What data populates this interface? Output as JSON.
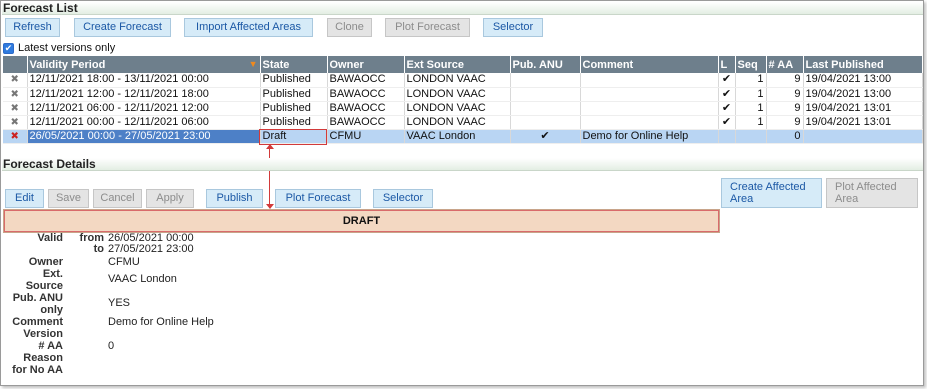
{
  "forecast_list": {
    "title": "Forecast List",
    "buttons": {
      "refresh": "Refresh",
      "create_forecast": "Create Forecast",
      "import_affected_areas": "Import Affected Areas",
      "clone": "Clone",
      "plot_forecast": "Plot Forecast",
      "selector": "Selector"
    },
    "latest_versions_label": "Latest versions only",
    "latest_versions_checked": true,
    "columns": [
      "Validity Period",
      "State",
      "Owner",
      "Ext Source",
      "Pub. ANU",
      "Comment",
      "L",
      "Seq",
      "# AA",
      "Last Published"
    ],
    "rows": [
      {
        "icon": "delete-icon",
        "period": "12/11/2021 18:00 - 13/11/2021 00:00",
        "state": "Published",
        "owner": "BAWAOCC",
        "ext_source": "LONDON VAAC",
        "pub_anu": "",
        "comment": "",
        "l": "✔",
        "seq": "1",
        "aa": "9",
        "last_published": "19/04/2021 13:00"
      },
      {
        "icon": "delete-icon",
        "period": "12/11/2021 12:00 - 12/11/2021 18:00",
        "state": "Published",
        "owner": "BAWAOCC",
        "ext_source": "LONDON VAAC",
        "pub_anu": "",
        "comment": "",
        "l": "✔",
        "seq": "1",
        "aa": "9",
        "last_published": "19/04/2021 13:00"
      },
      {
        "icon": "delete-icon",
        "period": "12/11/2021 06:00 - 12/11/2021 12:00",
        "state": "Published",
        "owner": "BAWAOCC",
        "ext_source": "LONDON VAAC",
        "pub_anu": "",
        "comment": "",
        "l": "✔",
        "seq": "1",
        "aa": "9",
        "last_published": "19/04/2021 13:01"
      },
      {
        "icon": "delete-icon",
        "period": "12/11/2021 00:00 - 12/11/2021 06:00",
        "state": "Published",
        "owner": "BAWAOCC",
        "ext_source": "LONDON VAAC",
        "pub_anu": "",
        "comment": "",
        "l": "✔",
        "seq": "1",
        "aa": "9",
        "last_published": "19/04/2021 13:01"
      },
      {
        "icon": "delete-icon",
        "period": "26/05/2021 00:00 - 27/05/2021 23:00",
        "state": "Draft",
        "owner": "CFMU",
        "ext_source": "VAAC London",
        "pub_anu": "✔",
        "comment": "Demo for Online Help",
        "l": "",
        "seq": "",
        "aa": "0",
        "last_published": ""
      }
    ]
  },
  "forecast_details": {
    "title": "Forecast Details",
    "buttons": {
      "edit": "Edit",
      "save": "Save",
      "cancel": "Cancel",
      "apply": "Apply",
      "publish": "Publish",
      "plot_forecast": "Plot Forecast",
      "selector": "Selector",
      "create_affected_area_1": "Create Affected",
      "create_affected_area_2": "Area",
      "plot_affected_area_1": "Plot Affected",
      "plot_affected_area_2": "Area"
    },
    "state_banner": "DRAFT",
    "fields": {
      "valid_label": "Valid",
      "from_label": "from",
      "from_value": "26/05/2021 00:00",
      "to_label": "to",
      "to_value": "27/05/2021 23:00",
      "owner_label": "Owner",
      "owner_value": "CFMU",
      "ext_source_label_1": "Ext.",
      "ext_source_label_2": "Source",
      "ext_source_value": "VAAC London",
      "pub_anu_label_1": "Pub. ANU",
      "pub_anu_label_2": "only",
      "pub_anu_value": "YES",
      "comment_label": "Comment",
      "comment_value": "Demo for Online Help",
      "version_label": "Version",
      "aa_label": "# AA",
      "aa_value": "0",
      "reason_label_1": "Reason",
      "reason_label_2": "for No AA"
    }
  },
  "colors": {
    "header_bg": "#6e7f8c",
    "button_bg": "#d6ebf8",
    "button_text": "#1b58a5",
    "selected_row": "#b9d5f3",
    "draft_banner": "#f3d8c2",
    "highlight": "#d23a3a"
  }
}
